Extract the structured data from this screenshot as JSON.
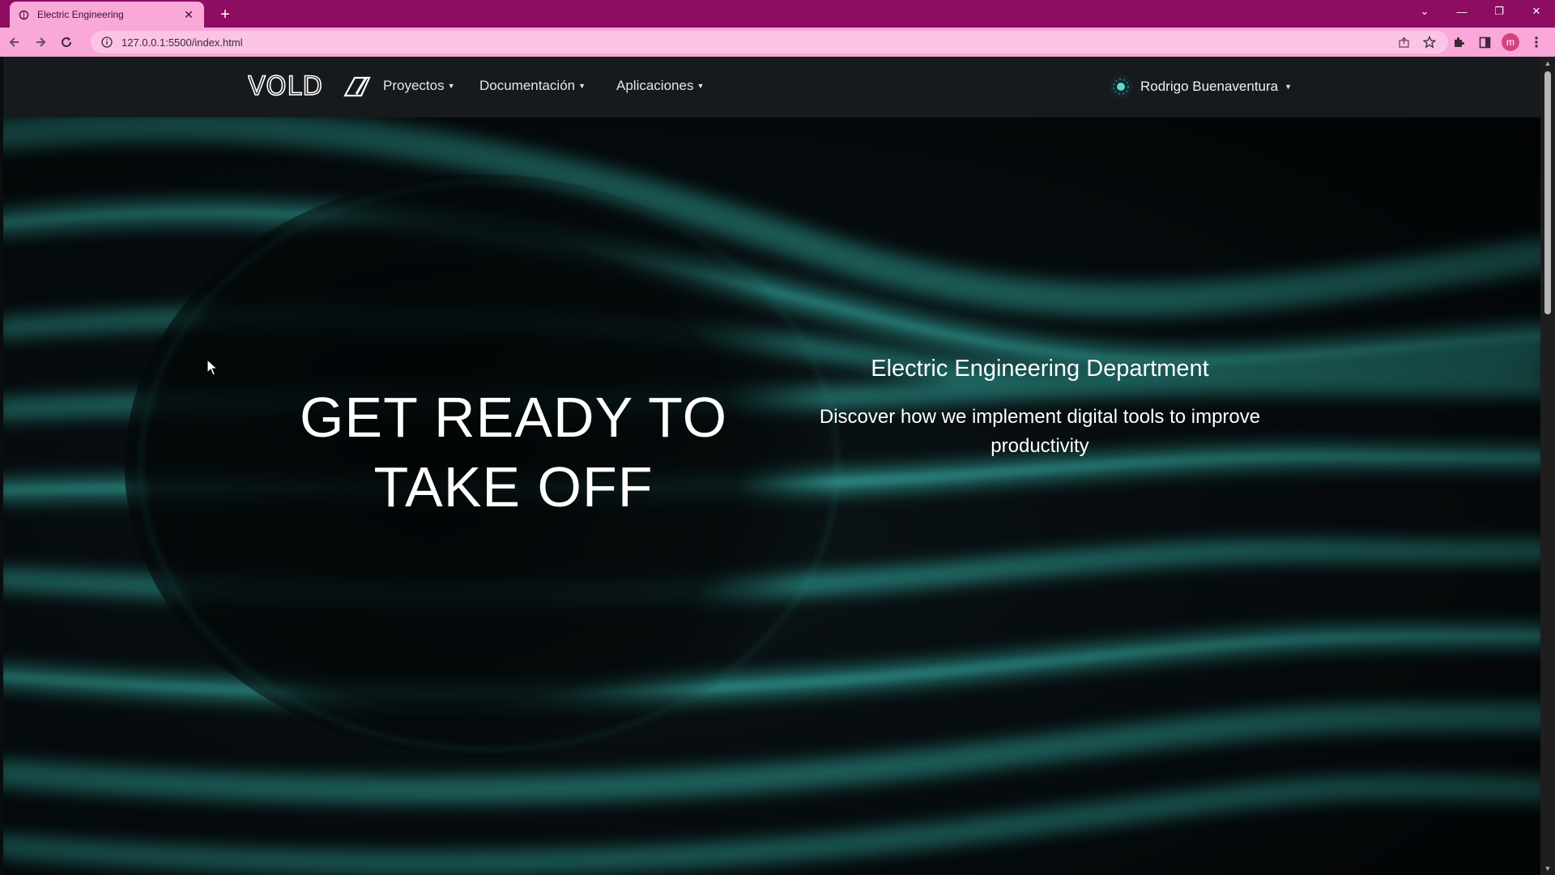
{
  "browser": {
    "tab_title": "Electric Engineering",
    "tab_close": "✕",
    "new_tab": "+",
    "url": "127.0.0.1:5500/index.html",
    "profile_initial": "m",
    "controls": {
      "dropdown": "⌄",
      "minimize": "—",
      "restore": "❐",
      "close": "✕"
    },
    "colors": {
      "tabstrip": "#8c0d62",
      "toolbar": "#f9a8d8"
    }
  },
  "site": {
    "brand": "VOLD",
    "nav": [
      {
        "label": "Proyectos"
      },
      {
        "label": "Documentación"
      },
      {
        "label": "Aplicaciones"
      }
    ],
    "user": {
      "name": "Rodrigo Buenaventura"
    }
  },
  "hero": {
    "title_line1": "GET READY TO",
    "title_line2": "TAKE OFF",
    "department": "Electric Engineering Department",
    "description": "Discover how we implement digital tools to improve productivity",
    "accent_color": "#2a8f88"
  }
}
